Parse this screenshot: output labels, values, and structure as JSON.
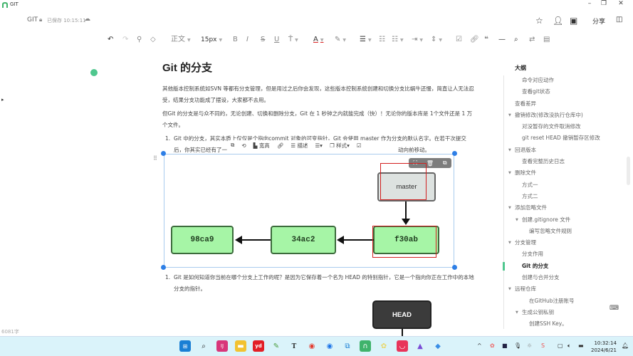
{
  "window": {
    "app_title": "GIT",
    "minimize": "–",
    "restore": "❐",
    "close": "✕"
  },
  "doc": {
    "name": "GIT",
    "saved_status": "已保存 10:15:11",
    "share_label": "分享"
  },
  "toolbar": {
    "para_style": "正文",
    "font_size": "15px",
    "bold": "B",
    "italic": "I",
    "strike": "S",
    "underline": "U",
    "font_color": "A"
  },
  "article": {
    "title": "Git 的分支",
    "para1": "其他版本控制系统如SVN 等都有分支管理，但是用过之后你会发现，这些版本控制系统创建和切换分支比蜗牛还慢，简直让人无法忍受，结果分支功能成了摆设，大家都不去用。",
    "para2": "但Git 的分支是与众不同的，无论创建、切换和删除分支，Git 在 1 秒钟之内就能完成（快）！无论你的版本库是 1个文件还是 1 万个文件。",
    "item1_num": "1.",
    "item1_line1": "Git 中的分支，其实本质上仅仅是个指向commit 对象的可变指针。Git 会使用 master 作为分支的默认名字。在若干次提交",
    "item1_line2_prefix": "后，你其实已经有了一",
    "item1_line2_suffix": "动向前移动。",
    "item2_num": "1.",
    "item2_text": "Git 是如何知道你当前在哪个分支上工作的呢？是因为它保存着一个名为 HEAD 的特别指针，它是一个指向你正在工作中的本地分支的指针。"
  },
  "image_toolbar": {
    "wide_label": "宽高",
    "describe_label": "描述",
    "style_label": "样式"
  },
  "diagram": {
    "commits": [
      "98ca9",
      "34ac2",
      "f30ab"
    ],
    "branch": "master",
    "head": "HEAD"
  },
  "outline": {
    "title": "大纲",
    "items": [
      {
        "label": "命令对应动作",
        "level": 2,
        "collapsible": false
      },
      {
        "label": "查看git状态",
        "level": 2,
        "collapsible": false
      },
      {
        "label": "查看差异",
        "level": 1,
        "collapsible": false
      },
      {
        "label": "撤销修改(修改没执行仓库中)",
        "level": 1,
        "collapsible": true
      },
      {
        "label": "对没暂存的文件取消修改",
        "level": 2,
        "collapsible": false
      },
      {
        "label": "git reset HEAD 撤销暂存区修改",
        "level": 2,
        "collapsible": false
      },
      {
        "label": "回退版本",
        "level": 1,
        "collapsible": true
      },
      {
        "label": "查看完整历史日志",
        "level": 2,
        "collapsible": false
      },
      {
        "label": "删除文件",
        "level": 1,
        "collapsible": true
      },
      {
        "label": "方式一",
        "level": 2,
        "collapsible": false
      },
      {
        "label": "方式二",
        "level": 2,
        "collapsible": false
      },
      {
        "label": "添加忽略文件",
        "level": 1,
        "collapsible": true
      },
      {
        "label": "创建.gitignore 文件",
        "level": 2,
        "collapsible": true
      },
      {
        "label": "编写忽略文件规则",
        "level": 3,
        "collapsible": false
      },
      {
        "label": "分支管理",
        "level": 1,
        "collapsible": true
      },
      {
        "label": "分支作用",
        "level": 2,
        "collapsible": false
      },
      {
        "label": "Git 的分支",
        "level": 2,
        "collapsible": false,
        "active": true
      },
      {
        "label": "创建与合并分支",
        "level": 2,
        "collapsible": false
      },
      {
        "label": "远程仓库",
        "level": 1,
        "collapsible": true
      },
      {
        "label": "在GitHub注册账号",
        "level": 3,
        "collapsible": false
      },
      {
        "label": "生成公钥私钥",
        "level": 2,
        "collapsible": true
      },
      {
        "label": "创建SSH Key。",
        "level": 3,
        "collapsible": false
      }
    ]
  },
  "status": {
    "word_count": "6081字"
  },
  "taskbar": {
    "time": "10:32:14",
    "date": "2024/6/21"
  },
  "colors": {
    "accent": "#4fc78e",
    "selection": "#2e7fe6",
    "commit_fill": "#a6f5a6",
    "annotation_red": "#d21f1f"
  }
}
